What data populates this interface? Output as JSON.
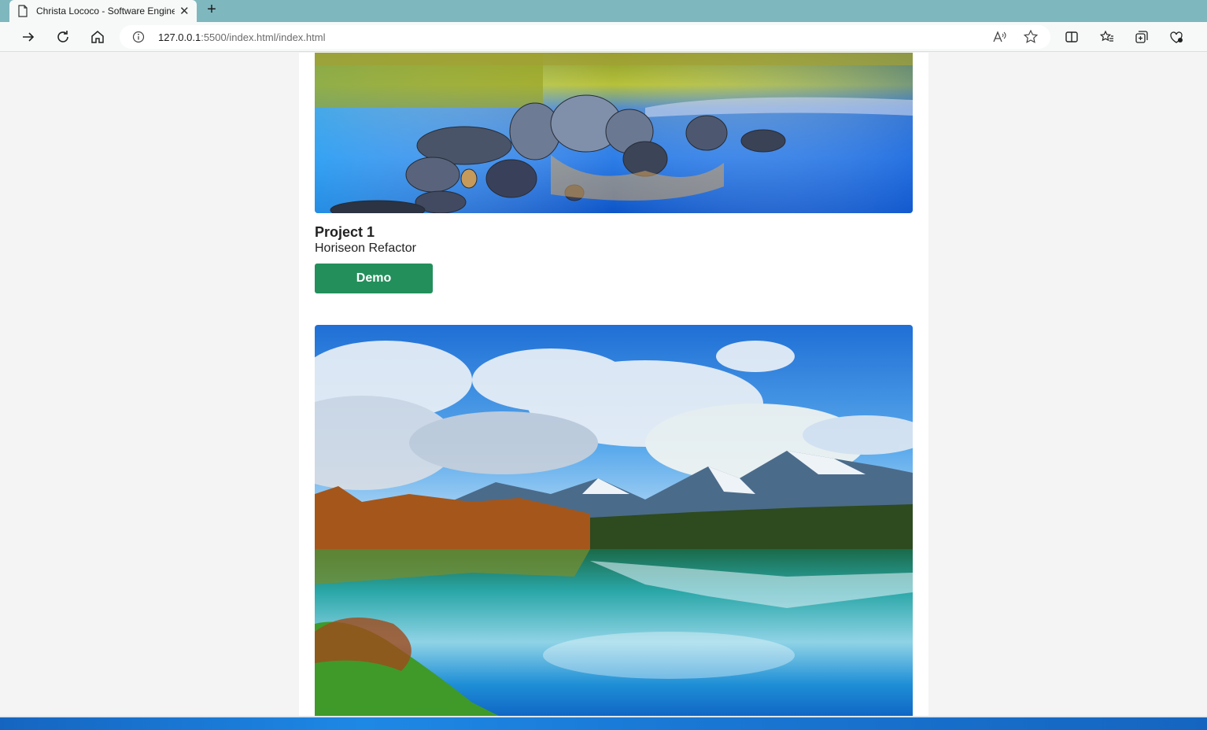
{
  "browser": {
    "tab_title": "Christa Lococo - Software Engine",
    "url_host": "127.0.0.1",
    "url_rest": ":5500/index.html/index.html"
  },
  "project1": {
    "title": "Project 1",
    "subtitle": "Horiseon Refactor",
    "demo_label": "Demo"
  },
  "colors": {
    "tabstrip": "#7fb7bf",
    "demo_button": "#238f5b"
  }
}
